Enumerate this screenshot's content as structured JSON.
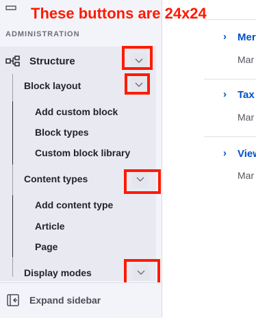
{
  "annotation": "These buttons are 24x24",
  "sidebar": {
    "section_title": "ADMINISTRATION",
    "structure_label": "Structure",
    "block_layout": {
      "label": "Block layout",
      "children": [
        "Add custom block",
        "Block types",
        "Custom block library"
      ]
    },
    "content_types": {
      "label": "Content types",
      "children": [
        "Add content type",
        "Article",
        "Page"
      ]
    },
    "display_modes_label": "Display modes",
    "footer_label": "Expand sidebar"
  },
  "main": {
    "items": [
      {
        "title": "Mer",
        "desc": "Mar"
      },
      {
        "title": "Tax",
        "desc": "Mar"
      },
      {
        "title": "View",
        "desc": "Mar"
      }
    ]
  },
  "colors": {
    "annotation": "#ff1a00",
    "link": "#0050c8"
  }
}
